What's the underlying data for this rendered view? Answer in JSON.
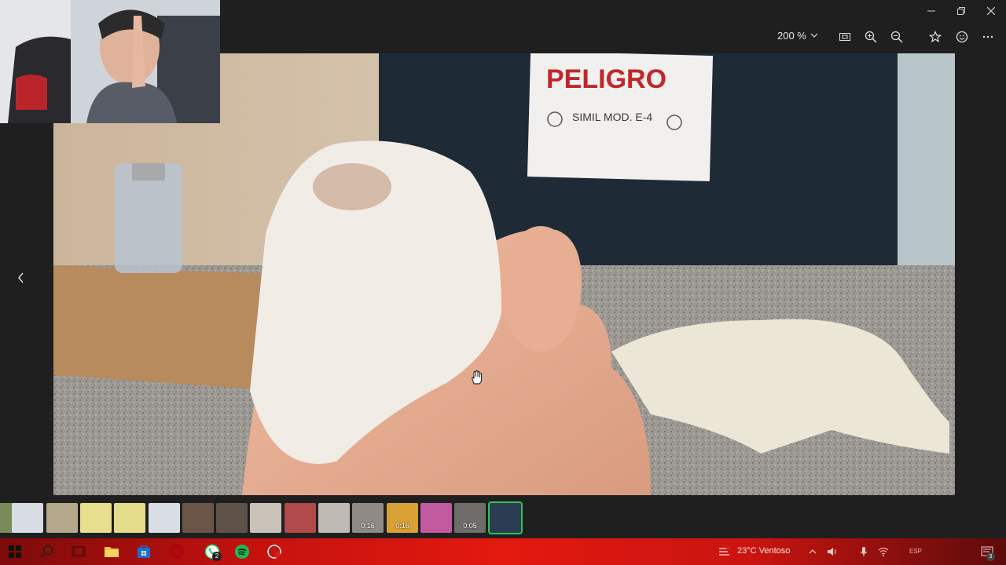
{
  "window": {
    "controls": [
      "minimize",
      "maximize",
      "close"
    ]
  },
  "toolbar": {
    "zoom_level": "200 %",
    "icons": [
      "fit-screen-icon",
      "zoom-in-icon",
      "zoom-out-icon",
      "favorite-icon",
      "emoji-icon",
      "more-icon"
    ]
  },
  "photo": {
    "sign_title": "PELIGRO",
    "sign_line2": "SIMIL MOD. E-4"
  },
  "filmstrip": {
    "thumbs": [
      {
        "dur": ""
      },
      {
        "dur": ""
      },
      {
        "dur": ""
      },
      {
        "dur": ""
      },
      {
        "dur": ""
      },
      {
        "dur": ""
      },
      {
        "dur": ""
      },
      {
        "dur": ""
      },
      {
        "dur": ""
      },
      {
        "dur": ""
      },
      {
        "dur": ""
      },
      {
        "dur": "0:16"
      },
      {
        "dur": ""
      },
      {
        "dur": "0:05"
      },
      {
        "dur": ""
      }
    ]
  },
  "taskbar": {
    "whatsapp_badge": "2",
    "weather": "23°C Ventoso",
    "lang": "ESP",
    "notif_count": "3"
  },
  "colors": {
    "accent_green": "#31c15a",
    "taskbar_red": "#e3190f",
    "background": "#1f1f1f"
  }
}
